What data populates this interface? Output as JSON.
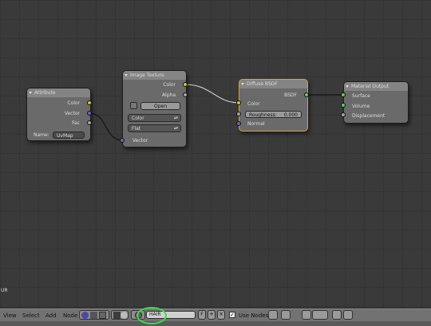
{
  "nodes": {
    "attribute": {
      "title": "Attribute",
      "outputs": [
        "Color",
        "Vector",
        "Fac"
      ],
      "name_label": "Name:",
      "name_value": "UvMap"
    },
    "image_texture": {
      "title": "Image Texture",
      "outputs": [
        "Color",
        "Alpha"
      ],
      "open_label": "Open",
      "color_space": "Color",
      "projection": "Flat",
      "input_vector": "Vector"
    },
    "diffuse_bsdf": {
      "title": "Diffuse BSDF",
      "output": "BSDF",
      "input_color": "Color",
      "roughness_label": "Roughness:",
      "roughness_value": "0.000",
      "input_normal": "Normal"
    },
    "material_output": {
      "title": "Material Output",
      "inputs": [
        "Surface",
        "Volume",
        "Displacement"
      ]
    }
  },
  "corner_label": "UR",
  "header": {
    "menus": [
      "View",
      "Select",
      "Add",
      "Node"
    ],
    "material_name": "HAIR",
    "fake_user_label": "F",
    "use_nodes_label": "Use Nodes",
    "use_nodes_checked": "✓"
  },
  "colors": {
    "socket_color": "#c7c729",
    "socket_vector": "#6363c7",
    "socket_float": "#a1a1a1",
    "socket_shader": "#63c763",
    "highlight": "#36e04a"
  }
}
